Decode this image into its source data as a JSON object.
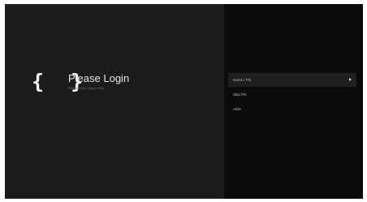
{
  "app": {
    "logo_text": "{ }",
    "title": "Please Login",
    "subtitle": "Please Enter Name / Pin"
  },
  "menu": {
    "items": [
      {
        "label": "Name / Pin",
        "selected": true,
        "has_arrow": true
      },
      {
        "label": "Skip Pin",
        "selected": false,
        "has_arrow": false
      },
      {
        "label": "Abile",
        "selected": false,
        "has_arrow": false
      }
    ]
  },
  "colors": {
    "left_panel": "#1c1c1c",
    "right_panel": "#0b0b0b",
    "selected_item": "#1f1f1f",
    "title_text": "#e6e6e6",
    "subtitle_text": "#6f6f6f",
    "menu_text": "#bdbdbd"
  }
}
